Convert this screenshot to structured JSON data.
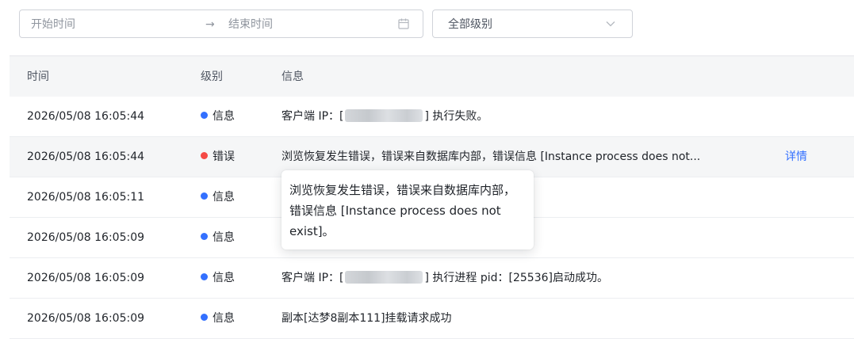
{
  "filters": {
    "start_placeholder": "开始时间",
    "range_arrow": "→",
    "end_placeholder": "结束时间",
    "calendar_icon": "calendar-icon",
    "level_value": "全部级别",
    "level_chevron_icon": "chevron-down-icon"
  },
  "table": {
    "headers": {
      "time": "时间",
      "level": "级别",
      "message": "信息"
    },
    "rows": [
      {
        "time": "2026/05/08 16:05:44",
        "level": "信息",
        "level_type": "info",
        "msg_prefix": "客户端 IP：[",
        "msg_redacted": true,
        "msg_suffix": "] 执行失败。"
      },
      {
        "time": "2026/05/08 16:05:44",
        "level": "错误",
        "level_type": "error",
        "msg_text": "浏览恢复发生错误，错误来自数据库内部，错误信息 [Instance process does not...",
        "detail_label": "详情"
      },
      {
        "time": "2026/05/08 16:05:11",
        "level": "信息",
        "level_type": "info"
      },
      {
        "time": "2026/05/08 16:05:09",
        "level": "信息",
        "level_type": "info"
      },
      {
        "time": "2026/05/08 16:05:09",
        "level": "信息",
        "level_type": "info",
        "msg_prefix": "客户端 IP：[",
        "msg_redacted": true,
        "msg_suffix": "] 执行进程 pid：[25536]启动成功。"
      },
      {
        "time": "2026/05/08 16:05:09",
        "level": "信息",
        "level_type": "info",
        "msg_text": "副本[达梦8副本111]挂载请求成功"
      }
    ]
  },
  "tooltip": {
    "text": "浏览恢复发生错误，错误来自数据库内部，错误信息 [Instance process does not exist]。"
  },
  "colors": {
    "info_dot": "#3370ff",
    "error_dot": "#f54a45",
    "link": "#3370ff",
    "header_bg": "#f5f6f7"
  }
}
